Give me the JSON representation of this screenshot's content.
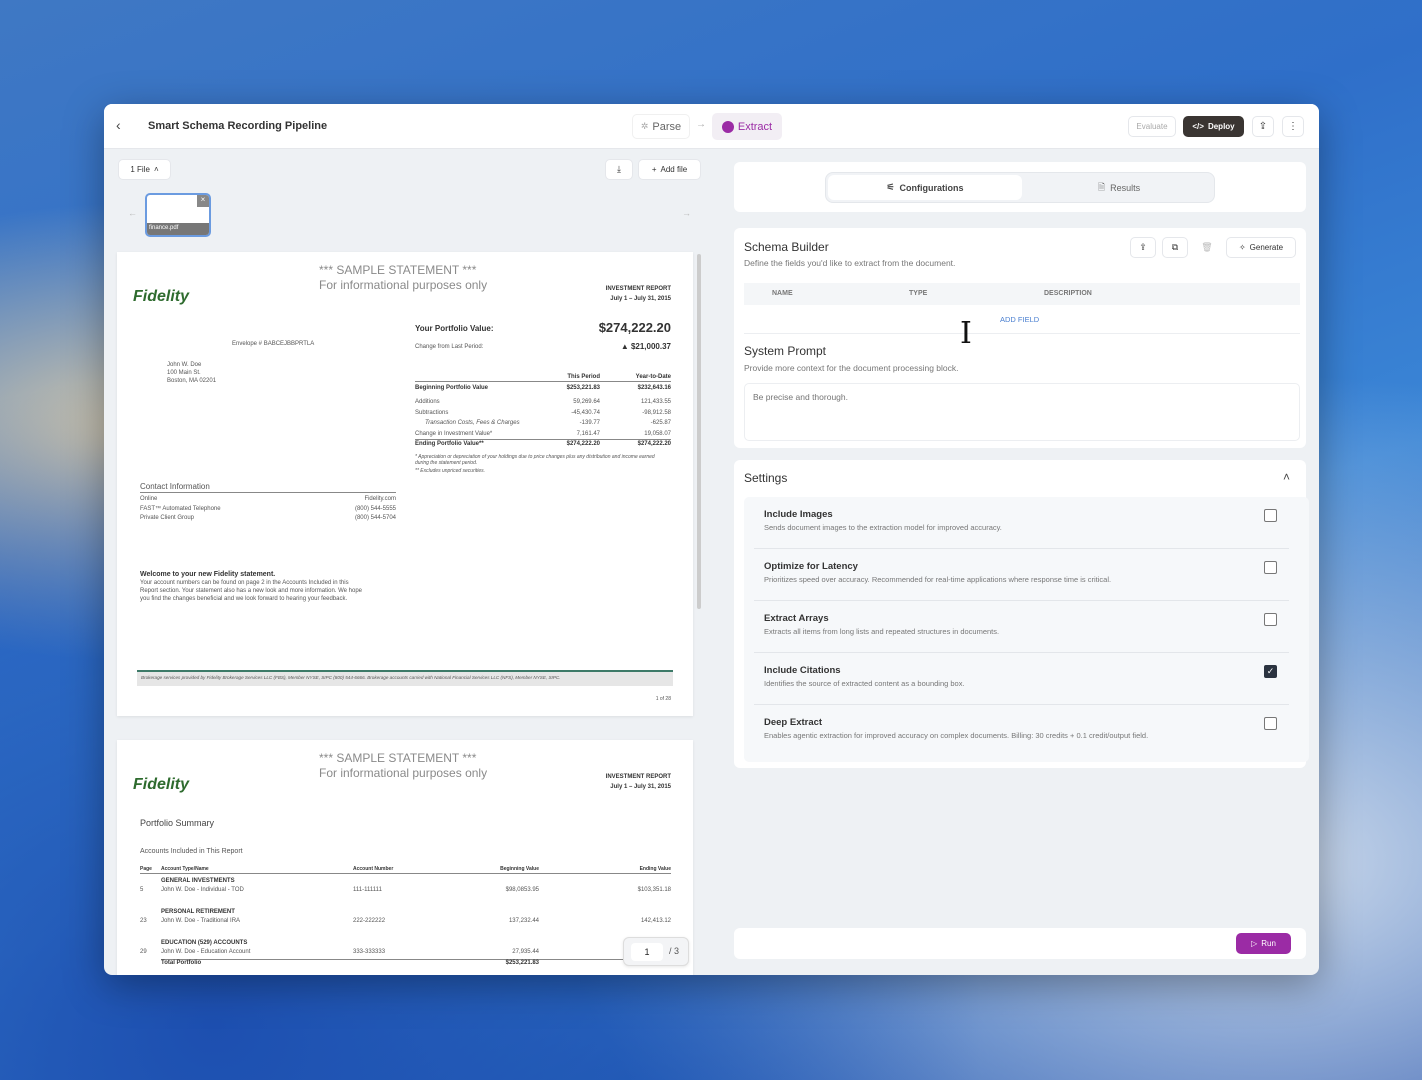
{
  "header": {
    "title": "Smart Schema Recording Pipeline",
    "steps": [
      {
        "label": "Parse"
      },
      {
        "label": "Extract"
      }
    ],
    "evaluate": "Evaluate",
    "deploy": "Deploy",
    "accent": "#9b2ba5"
  },
  "files": {
    "count_label": "1 File",
    "add_file": "Add file",
    "thumb_name": "finance.pdf"
  },
  "doc": {
    "page1": {
      "sample": "*** SAMPLE STATEMENT ***",
      "info": "For informational purposes only",
      "logo": "Fidelity",
      "report": "INVESTMENT REPORT",
      "period": "July 1 – July 31, 2015",
      "portfolio_label": "Your Portfolio Value:",
      "portfolio_value": "$274,222.20",
      "change_label": "Change from Last Period:",
      "change_value": "▲  $21,000.37",
      "envelope": "Envelope # BABCEJBBPRTLA",
      "address": [
        "John W. Doe",
        "100 Main St.",
        "Boston, MA 02201"
      ],
      "table_headers": [
        "This Period",
        "Year-to-Date"
      ],
      "rows": [
        {
          "label": "Beginning Portfolio Value",
          "a": "$253,221.83",
          "b": "$232,643.16",
          "bold": true
        },
        {
          "label": "Additions",
          "a": "59,269.64",
          "b": "121,433.55"
        },
        {
          "label": "Subtractions",
          "a": "-45,430.74",
          "b": "-98,912.58"
        },
        {
          "label": "Transaction Costs, Fees & Charges",
          "a": "-139.77",
          "b": "-625.87"
        },
        {
          "label": "Change in Investment Value*",
          "a": "7,161.47",
          "b": "19,058.07"
        },
        {
          "label": "Ending Portfolio Value**",
          "a": "$274,222.20",
          "b": "$274,222.20",
          "bold": true
        }
      ],
      "footnote1": "*   Appreciation or depreciation of your holdings due to price changes plus any distribution and income earned during the statement period.",
      "footnote2": "**  Excludes unpriced securities.",
      "contact_title": "Contact Information",
      "contacts": [
        {
          "k": "Online",
          "v": "Fidelity.com"
        },
        {
          "k": "FAST™ Automated Telephone",
          "v": "(800) 544-5555"
        },
        {
          "k": "Private Client Group",
          "v": "(800) 544-5704"
        }
      ],
      "welcome_title": "Welcome to your new Fidelity statement.",
      "welcome_body": [
        "Your account numbers can be found on page 2 in the Accounts Included in this",
        "Report section. Your statement also has a new look and more information. We hope",
        "you find the changes beneficial and we look forward to hearing your feedback."
      ],
      "footer": "Brokerage services provided by Fidelity Brokerage Services LLC (FBS), Member NYSE, SIPC (800) 544-6666. Brokerage accounts carried with National Financial Services LLC (NFS), Member NYSE, SIPC.",
      "page_no": "1 of 28"
    },
    "page2": {
      "summary": "Portfolio Summary",
      "accounts_title": "Accounts Included in This Report",
      "headers": [
        "Page",
        "Account Type/Name",
        "Account Number",
        "Beginning Value",
        "Ending Value"
      ],
      "groups": [
        {
          "name": "GENERAL INVESTMENTS",
          "page": "5",
          "acct": "John W. Doe - Individual - TOD",
          "num": "111-111111",
          "begin": "$98,0853.95",
          "end": "$103,351.18"
        },
        {
          "name": "PERSONAL RETIREMENT",
          "page": "23",
          "acct": "John W. Doe - Traditional IRA",
          "num": "222-222222",
          "begin": "137,232.44",
          "end": "142,413.12"
        },
        {
          "name": "EDUCATION (529) ACCOUNTS",
          "page": "29",
          "acct": "John W. Doe - Education Account",
          "num": "333-333333",
          "begin": "27,935.44",
          "end": ""
        }
      ],
      "total_label": "Total Portfolio",
      "total_begin": "$253,221.83"
    },
    "pager": {
      "current": "1",
      "total": "/ 3"
    }
  },
  "tabs": {
    "config": "Configurations",
    "results": "Results"
  },
  "schema": {
    "title": "Schema Builder",
    "subtitle": "Define the fields you'd like to extract from the document.",
    "generate": "Generate",
    "cols": [
      "NAME",
      "TYPE",
      "DESCRIPTION"
    ],
    "add_field": "ADD FIELD"
  },
  "prompt": {
    "title": "System Prompt",
    "subtitle": "Provide more context for the document processing block.",
    "placeholder": "Be precise and thorough."
  },
  "settings": {
    "title": "Settings",
    "items": [
      {
        "name": "Include Images",
        "desc": "Sends document images to the extraction model for improved accuracy.",
        "checked": false
      },
      {
        "name": "Optimize for Latency",
        "desc": "Prioritizes speed over accuracy. Recommended for real-time applications where response time is critical.",
        "checked": false
      },
      {
        "name": "Extract Arrays",
        "desc": "Extracts all items from long lists and repeated structures in documents.",
        "checked": false
      },
      {
        "name": "Include Citations",
        "desc": "Identifies the source of extracted content as a bounding box.",
        "checked": true
      },
      {
        "name": "Deep Extract",
        "desc": "Enables agentic extraction for improved accuracy on complex documents. Billing: 30 credits + 0.1 credit/output field.",
        "checked": false
      }
    ]
  },
  "run": "Run"
}
